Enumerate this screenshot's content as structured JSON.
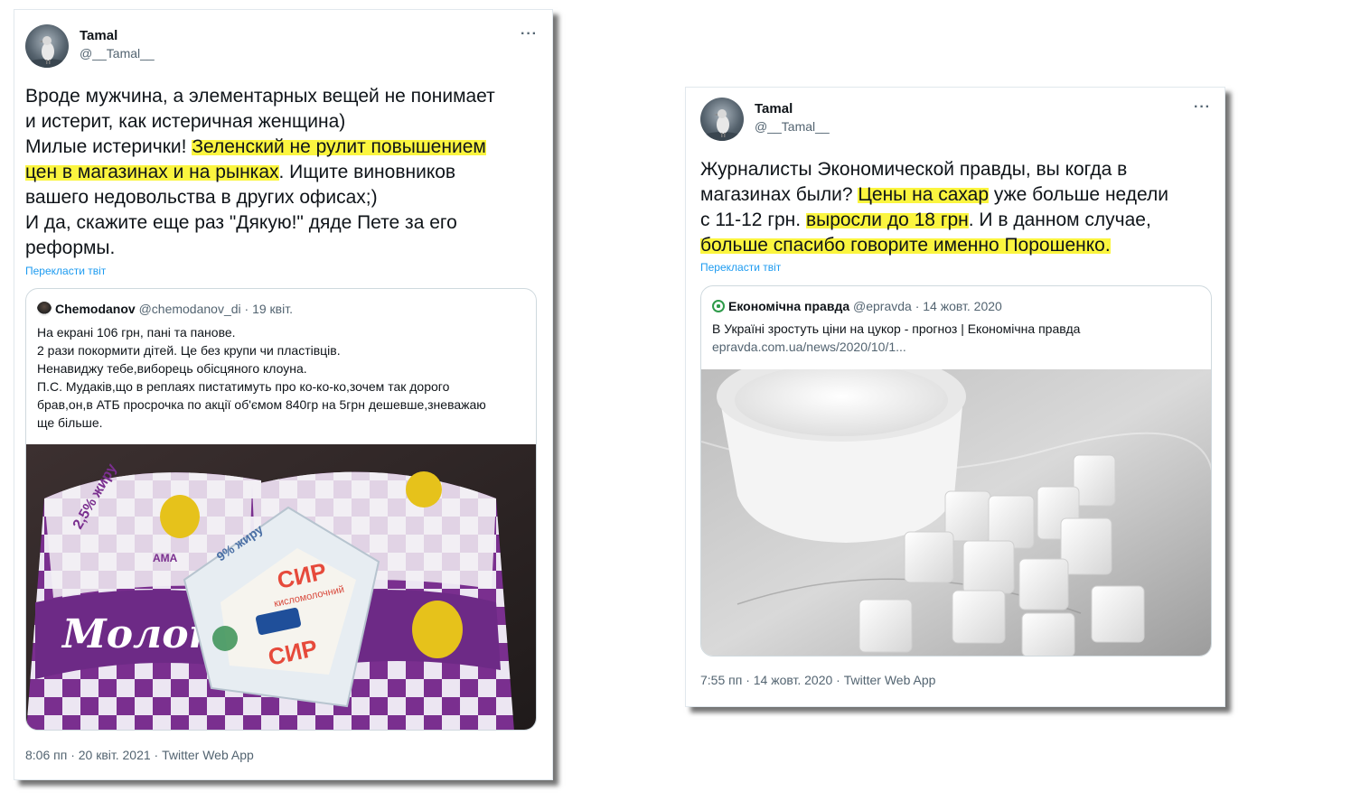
{
  "tweet1": {
    "name": "Tamal",
    "handle": "@__Tamal__",
    "more": "···",
    "text_a": "Вроде мужчина, а элементарных вещей не понимает\nи истерит, как истеричная женщина)\nМилые истерички! ",
    "text_hl": "Зеленский не рулит повышением\nцен в магазинах и на рынках",
    "text_b": ". Ищите виновников\nвашего недовольства в других офисах;)\nИ да, скажите еще раз \"Дякую!\" дяде Пете за его\nреформы.",
    "translate": "Перекласти твіт",
    "quote": {
      "name": "Chemodanov",
      "handle": "@chemodanov_di",
      "date": "· 19 квіт.",
      "lines": [
        "На екрані 106 грн, пані та панове.",
        "2 рази покормити дітей. Це без крупи чи пластівців.",
        "Ненавиджу тебе,виборець обісцяного клоуна.",
        "П.С. Мудаків,що в реплаях пистатимуть про ко-ко-ко,зочем так дорого",
        "брав,он,в АТБ просрочка по акції об'ємом 840гр на 5грн дешевше,зневажаю",
        "ще більше."
      ],
      "image_labels": {
        "milk_word": "Молоко",
        "milk_fat": "2,5% жиру",
        "cheese_word": "СИР",
        "cheese_sub": "кисломолочний",
        "brand": "АМА",
        "cheese_fat": "9% жиру"
      }
    },
    "footer": "8:06 пп · 20 квіт. 2021 · Twitter Web App"
  },
  "tweet2": {
    "name": "Tamal",
    "handle": "@__Tamal__",
    "more": "···",
    "t1": "Журналисты Экономической правды, вы когда в\nмагазинах были? ",
    "h1": "Цены на сахар",
    "t2": " уже больше недели\nс 11-12 грн. ",
    "h2": "выросли до 18 грн",
    "t3": ". И в данном случае,\n",
    "h3": "больше спасибо говорите именно Порошенко.",
    "translate": "Перекласти твіт",
    "quote": {
      "name": "Економічна правда",
      "handle": "@epravda",
      "date": "· 14 жовт. 2020",
      "line1": "В Україні зростуть ціни на цукор - прогноз | Економічна правда",
      "line2": "epravda.com.ua/news/2020/10/1..."
    },
    "footer": "7:55 пп · 14 жовт. 2020 · Twitter Web App"
  },
  "colors": {
    "highlight": "#fbf53f",
    "link": "#1d9bf0",
    "muted": "#536471",
    "milk_purple": "#7a2f8f"
  },
  "icons": [
    "more-icon",
    "avatar-pigeon",
    "epravda-logo-icon"
  ]
}
